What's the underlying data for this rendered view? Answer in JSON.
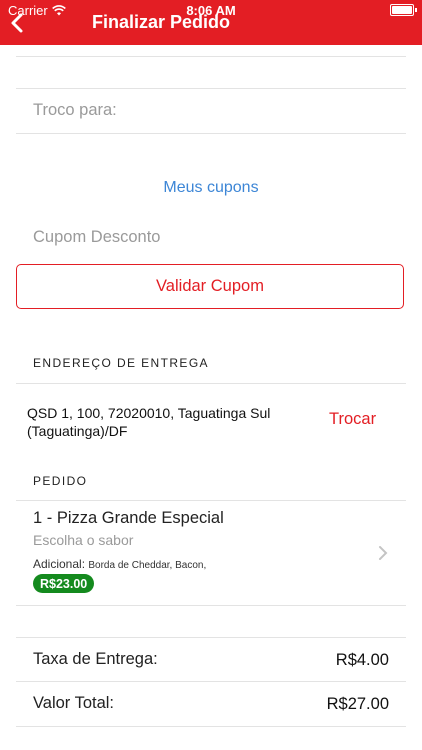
{
  "status_bar": {
    "carrier": "Carrier",
    "time": "8:06 AM"
  },
  "header": {
    "title": "Finalizar Pedido"
  },
  "form": {
    "troco_placeholder": "Troco para:",
    "meus_cupons": "Meus cupons",
    "cupom_placeholder": "Cupom Desconto",
    "validate_label": "Validar Cupom"
  },
  "address_section": {
    "heading": "ENDEREÇO DE ENTREGA",
    "address": "QSD 1, 100, 72020010, Taguatinga Sul (Taguatinga)/DF",
    "change_label": "Trocar"
  },
  "order_section": {
    "heading": "PEDIDO",
    "item": {
      "title": "1 - Pizza Grande Especial",
      "subtitle": "Escolha o sabor",
      "additional_label": "Adicional:",
      "additional_items": "Borda de Cheddar, Bacon,",
      "price": "R$23.00"
    }
  },
  "totals": {
    "delivery_label": "Taxa de Entrega:",
    "delivery_value": "R$4.00",
    "total_label": "Valor Total:",
    "total_value": "R$27.00"
  },
  "colors": {
    "accent": "#e31e24",
    "link": "#3d86d6",
    "price_badge": "#148a1e"
  }
}
